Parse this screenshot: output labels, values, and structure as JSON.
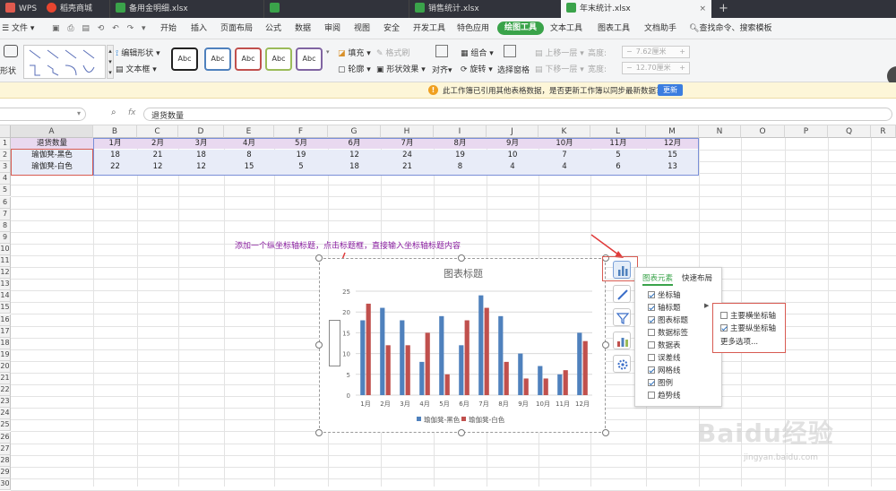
{
  "tabs": [
    {
      "label": "WPS"
    },
    {
      "label": "稻壳商城"
    },
    {
      "label": "备用金明细.xlsx"
    },
    {
      "label": ""
    },
    {
      "label": "销售统计.xlsx"
    },
    {
      "label": "年末统计.xlsx"
    }
  ],
  "menu": {
    "file": "文件",
    "items": [
      "开始",
      "插入",
      "页面布局",
      "公式",
      "数据",
      "审阅",
      "视图",
      "安全",
      "开发工具",
      "特色应用",
      "绘图工具",
      "文本工具",
      "图表工具",
      "文档助手"
    ],
    "search": "查找命令、搜索模板"
  },
  "ribbon": {
    "shape": "形状",
    "edit_shape": "编辑形状",
    "textbox": "文本框",
    "styles": [
      "Abc",
      "Abc",
      "Abc",
      "Abc",
      "Abc"
    ],
    "fill": "填充",
    "format_brush": "格式刷",
    "outline": "轮廓",
    "shape_effect": "形状效果",
    "align": "对齐",
    "group": "组合",
    "rotate": "旋转",
    "selection_pane": "选择窗格",
    "up_one": "上移一层",
    "down_one": "下移一层",
    "height_label": "高度:",
    "height_value": "7.62厘米",
    "width_label": "宽度:",
    "width_value": "12.70厘米"
  },
  "notification": {
    "text": "此工作簿已引用其他表格数据，是否更新工作簿以同步最新数据？",
    "button": "更新"
  },
  "formula_bar": {
    "fx": "fx",
    "content": "退货数量"
  },
  "sheet": {
    "columns": [
      "A",
      "B",
      "C",
      "D",
      "E",
      "F",
      "G",
      "H",
      "I",
      "J",
      "K",
      "L",
      "M",
      "N",
      "O",
      "P",
      "Q",
      "R"
    ],
    "rows": [
      "1",
      "2",
      "3",
      "4",
      "5",
      "6",
      "7",
      "8",
      "9",
      "10",
      "11",
      "12",
      "13",
      "14",
      "15",
      "16",
      "17",
      "18",
      "19",
      "20",
      "21",
      "22",
      "23",
      "24",
      "25",
      "26",
      "27",
      "28",
      "29",
      "30"
    ],
    "cells": [
      [
        "退货数量",
        "1月",
        "2月",
        "3月",
        "4月",
        "5月",
        "6月",
        "7月",
        "8月",
        "9月",
        "10月",
        "11月",
        "12月"
      ],
      [
        "瑜伽凳-黑色",
        "18",
        "21",
        "18",
        "8",
        "19",
        "12",
        "24",
        "19",
        "10",
        "7",
        "5",
        "15"
      ],
      [
        "瑜伽凳-白色",
        "22",
        "12",
        "12",
        "15",
        "5",
        "18",
        "21",
        "8",
        "4",
        "4",
        "6",
        "13"
      ]
    ]
  },
  "annotation": "添加一个纵坐标轴标题，点击标题框，直接输入坐标轴标题内容",
  "chart_data": {
    "type": "bar",
    "title": "图表标题",
    "ylabel": "坐标轴标题",
    "xlabel": "",
    "categories": [
      "1月",
      "2月",
      "3月",
      "4月",
      "5月",
      "6月",
      "7月",
      "8月",
      "9月",
      "10月",
      "11月",
      "12月"
    ],
    "series": [
      {
        "name": "瑜伽凳-黑色",
        "values": [
          18,
          21,
          18,
          8,
          19,
          12,
          24,
          19,
          10,
          7,
          5,
          15
        ],
        "color": "#4f81bd"
      },
      {
        "name": "瑜伽凳-白色",
        "values": [
          22,
          12,
          12,
          15,
          5,
          18,
          21,
          8,
          4,
          4,
          6,
          13
        ],
        "color": "#c0504d"
      }
    ],
    "ylim": [
      0,
      25
    ],
    "yticks": [
      "0",
      "5",
      "10",
      "15",
      "20",
      "25"
    ],
    "grid": true,
    "legend": "bottom"
  },
  "chart_elements": {
    "tab_elements": "图表元素",
    "tab_layout": "快速布局",
    "items": [
      {
        "label": "坐标轴",
        "checked": true
      },
      {
        "label": "轴标题",
        "checked": true
      },
      {
        "label": "图表标题",
        "checked": true
      },
      {
        "label": "数据标签",
        "checked": false
      },
      {
        "label": "数据表",
        "checked": false
      },
      {
        "label": "误差线",
        "checked": false
      },
      {
        "label": "网格线",
        "checked": true
      },
      {
        "label": "图例",
        "checked": true
      },
      {
        "label": "趋势线",
        "checked": false
      }
    ],
    "submenu": [
      {
        "label": "主要横坐标轴",
        "checked": false
      },
      {
        "label": "主要纵坐标轴",
        "checked": true
      }
    ],
    "more": "更多选项..."
  },
  "watermark": {
    "brand": "Baidu经验",
    "url": "jingyan.baidu.com"
  },
  "colors": {
    "accent": "#3aa34a",
    "header_row": "#e9d9f0",
    "data_row": "#e8ecf8",
    "arrow": "#e03a3a"
  }
}
